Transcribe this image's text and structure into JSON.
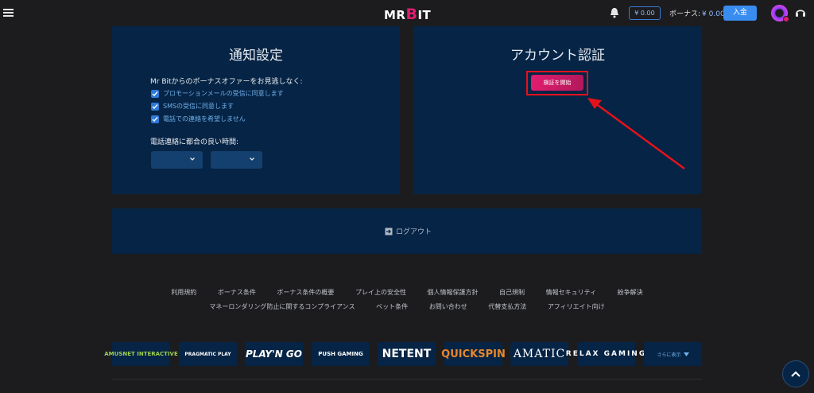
{
  "header": {
    "logo_text": "MR.BIT",
    "logo_prefix": "MR",
    "logo_b": "B",
    "logo_suffix": "IT",
    "balance": "¥ 0.00",
    "bonus_label": "ボーナス:",
    "bonus_value": "¥ 0.00",
    "deposit_label": "入金",
    "icons": [
      "menu-icon",
      "bell-icon",
      "avatar",
      "headset-icon"
    ]
  },
  "notifications": {
    "title": "通知設定",
    "intro": "Mr Bitからのボーナスオファーをお見逃しなく:",
    "options": [
      {
        "label": "プロモーションメールの受信に同意します",
        "checked": true
      },
      {
        "label": "SMSの受信に同意します",
        "checked": true
      },
      {
        "label": "電話での連絡を希望しません",
        "checked": true
      }
    ],
    "time_label": "電話連絡に都合の良い時間:",
    "selects": [
      {
        "value": ""
      },
      {
        "value": ""
      }
    ]
  },
  "verification": {
    "title": "アカウント認証",
    "button_label": "検証を開始",
    "annotation_color": "#e4121b"
  },
  "logout": {
    "label": "ログアウト"
  },
  "footer": {
    "links_row1": [
      "利用規約",
      "ボーナス条件",
      "ボーナス条件の概要",
      "プレイ上の安全性",
      "個人情報保護方針",
      "自己規制",
      "情報セキュリティ",
      "紛争解決"
    ],
    "links_row2": [
      "マネーロンダリング防止に関するコンプライアンス",
      "ベット条件",
      "お問い合わせ",
      "代替支払方法",
      "アフィリエイト向け"
    ],
    "providers": [
      "AMUSNET INTERACTIVE",
      "PRAGMATIC PLAY",
      "PLAY'N GO",
      "PUSH GAMING",
      "NETENT",
      "QUICKSPIN",
      "AMATIC",
      "RELAX GAMING"
    ],
    "more_label": "さらに表示"
  },
  "colors": {
    "background": "#1c1c1f",
    "panel": "#062445",
    "accent_pink": "#e01d6e",
    "accent_blue": "#3a8df0"
  }
}
